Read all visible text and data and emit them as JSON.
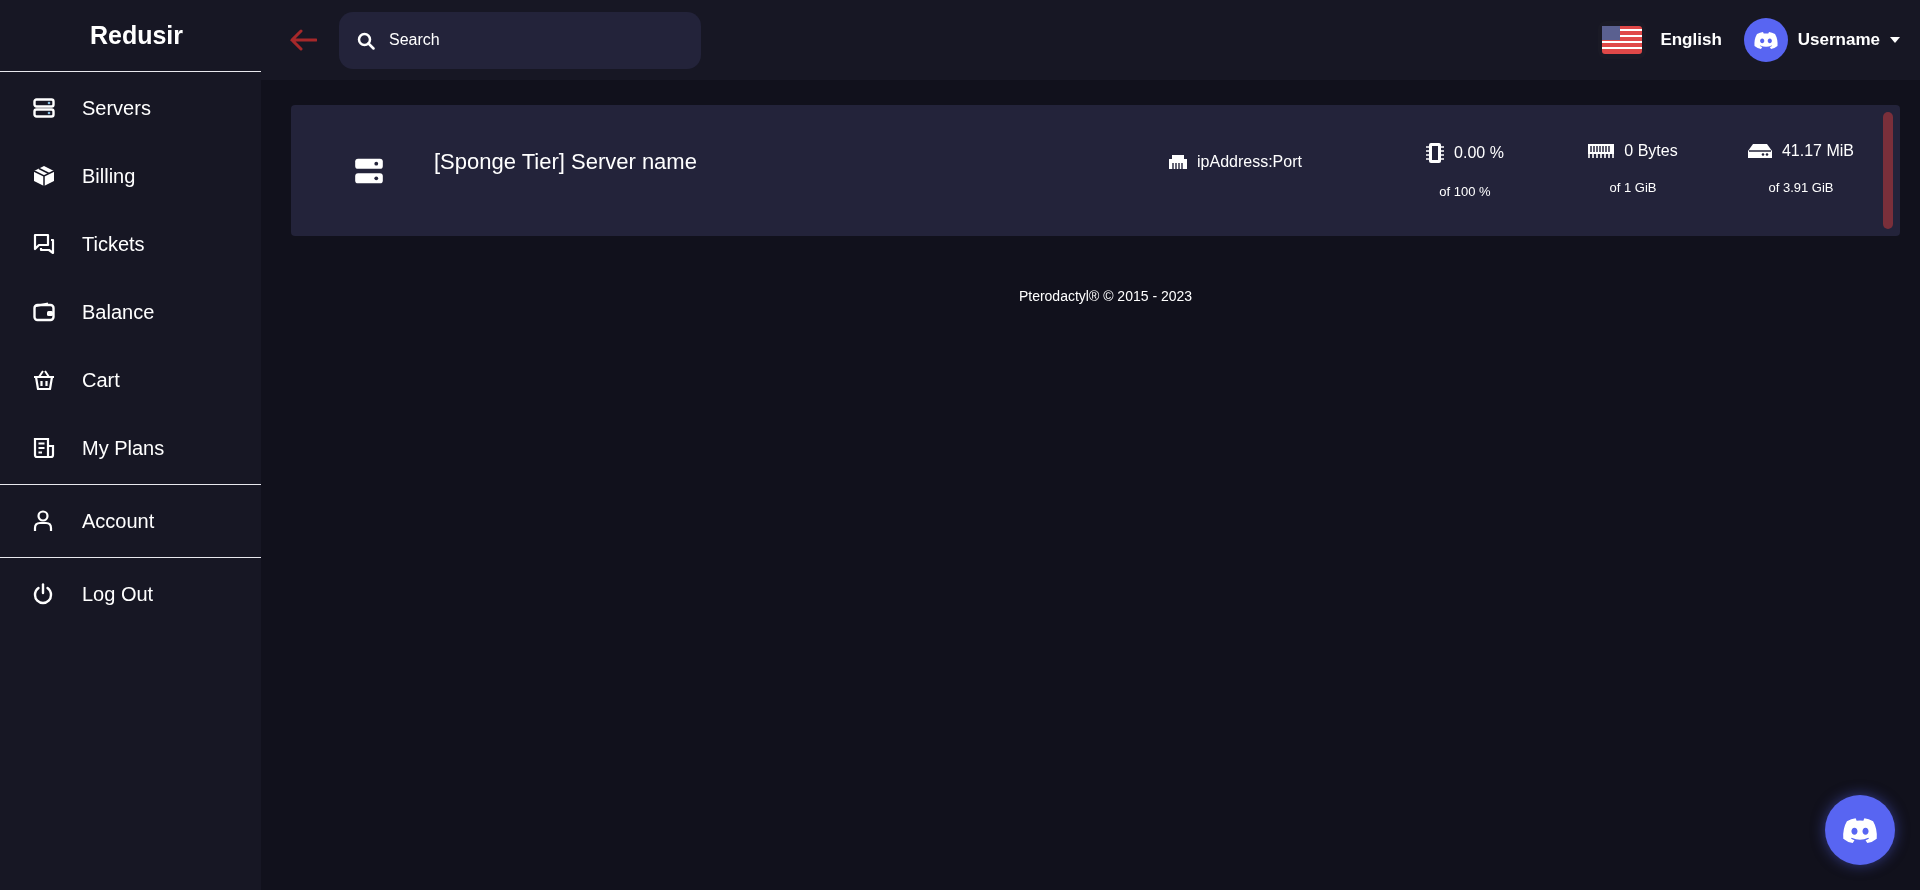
{
  "sidebar": {
    "title": "Redusir",
    "sections": [
      [
        {
          "label": "Servers",
          "kind": "servers"
        },
        {
          "label": "Billing",
          "kind": "billing"
        },
        {
          "label": "Tickets",
          "kind": "tickets"
        },
        {
          "label": "Balance",
          "kind": "balance"
        },
        {
          "label": "Cart",
          "kind": "cart"
        },
        {
          "label": "My Plans",
          "kind": "plans"
        }
      ],
      [
        {
          "label": "Account",
          "kind": "account"
        }
      ],
      [
        {
          "label": "Log Out",
          "kind": "logout"
        }
      ]
    ]
  },
  "header": {
    "search": {
      "placeholder": "Search"
    },
    "language": "English",
    "username": "Username"
  },
  "servers": [
    {
      "name": "[Sponge Tier] Server name",
      "address": "ipAddress:Port",
      "color": "#7a2f3a",
      "stats": [
        {
          "kind": "cpu",
          "value": "0.00 %",
          "limit": "of 100 %"
        },
        {
          "kind": "memory",
          "value": "0 Bytes",
          "limit": "of 1 GiB"
        },
        {
          "kind": "disk",
          "value": "41.17 MiB",
          "limit": "of 3.91 GiB"
        }
      ]
    }
  ],
  "footer": "Pterodactyl® © 2015 - 2023"
}
